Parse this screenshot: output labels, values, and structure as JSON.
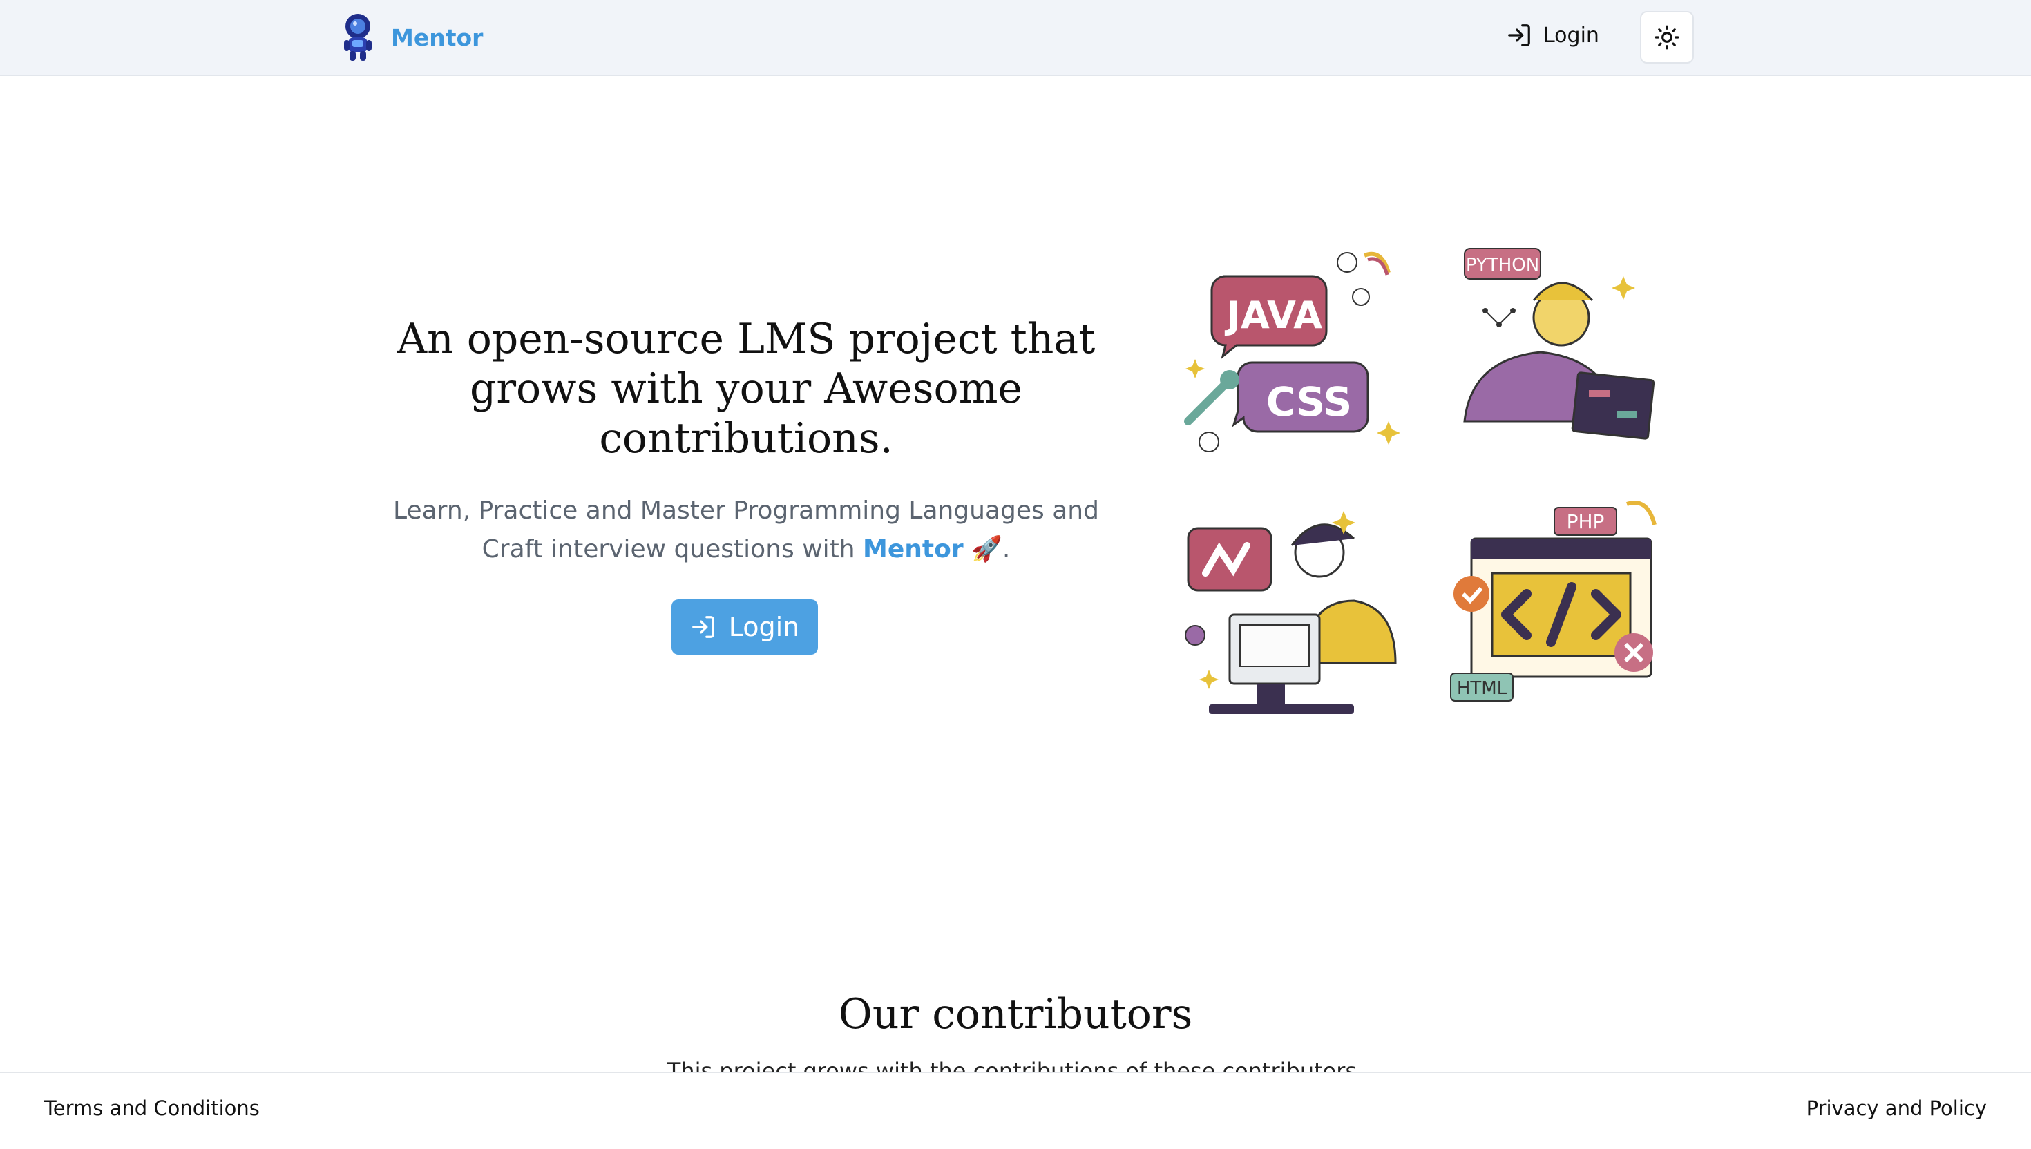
{
  "header": {
    "brand": "Mentor",
    "login_label": "Login",
    "theme_toggle_icon": "sun-icon"
  },
  "hero": {
    "title": "An open-source LMS project that grows with your Awesome contributions.",
    "subtitle_prefix": "Learn, Practice and Master Programming Languages and Craft interview questions with ",
    "subtitle_brand": "Mentor",
    "subtitle_suffix": " 🚀.",
    "login_button": "Login"
  },
  "illustrations": {
    "java_label": "JAVA",
    "css_label": "CSS",
    "python_label": "PYTHON",
    "php_label": "PHP",
    "html_label": "HTML"
  },
  "contributors": {
    "title": "Our contributors",
    "subtitle": "This project grows with the contributions of these contributors."
  },
  "footer": {
    "terms": "Terms and Conditions",
    "privacy": "Privacy and Policy"
  },
  "colors": {
    "accent": "#3d96dc",
    "button": "#4da1e2",
    "header_bg": "#f1f4f9"
  }
}
